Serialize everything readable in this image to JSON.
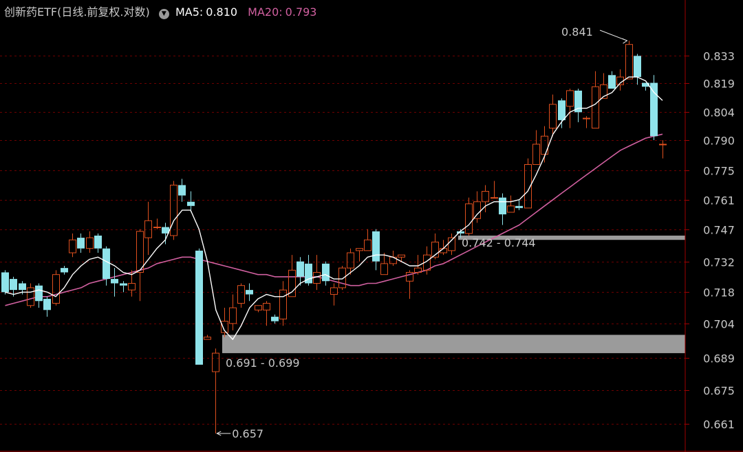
{
  "header": {
    "title": "创新药ETF(日线.前复权.对数)",
    "ma5_label": "MA5:",
    "ma5_value": "0.810",
    "ma20_label": "MA20:",
    "ma20_value": "0.793",
    "toggle_icon": "chevron-down-icon"
  },
  "colors": {
    "background": "#000000",
    "grid": "#6e0000",
    "axis": "#a00000",
    "up": "#e0501e",
    "down": "#8fe3ea",
    "ma5": "#ffffff",
    "ma20": "#d160a0",
    "zone": "#9b9b9b"
  },
  "chart_data": {
    "type": "candlestick",
    "scale": "log",
    "y_ticks": [
      "0.833",
      "0.819",
      "0.804",
      "0.790",
      "0.775",
      "0.761",
      "0.747",
      "0.732",
      "0.718",
      "0.704",
      "0.689",
      "0.675",
      "0.661"
    ],
    "ylim": [
      0.655,
      0.848
    ],
    "grid": true,
    "annotations": [
      {
        "text": "0.841",
        "price": 0.841,
        "type": "high"
      },
      {
        "text": "0.657",
        "price": 0.657,
        "type": "low"
      }
    ],
    "zones": [
      {
        "label": "0.691 - 0.699",
        "low": 0.691,
        "high": 0.699
      },
      {
        "label": "0.742 - 0.744",
        "low": 0.742,
        "high": 0.744
      }
    ],
    "candles": [
      [
        0.727,
        0.718,
        0.728,
        0.717
      ],
      [
        0.724,
        0.719,
        0.725,
        0.716
      ],
      [
        0.722,
        0.719,
        0.723,
        0.717
      ],
      [
        0.712,
        0.72,
        0.722,
        0.711
      ],
      [
        0.721,
        0.714,
        0.722,
        0.711
      ],
      [
        0.715,
        0.71,
        0.716,
        0.707
      ],
      [
        0.713,
        0.726,
        0.728,
        0.712
      ],
      [
        0.729,
        0.727,
        0.73,
        0.726
      ],
      [
        0.736,
        0.742,
        0.745,
        0.734
      ],
      [
        0.743,
        0.738,
        0.745,
        0.736
      ],
      [
        0.738,
        0.743,
        0.746,
        0.736
      ],
      [
        0.744,
        0.738,
        0.745,
        0.736
      ],
      [
        0.738,
        0.724,
        0.739,
        0.721
      ],
      [
        0.724,
        0.722,
        0.729,
        0.716
      ],
      [
        0.722,
        0.721,
        0.723,
        0.718
      ],
      [
        0.719,
        0.722,
        0.728,
        0.716
      ],
      [
        0.727,
        0.746,
        0.747,
        0.714
      ],
      [
        0.743,
        0.751,
        0.76,
        0.735
      ],
      [
        0.748,
        0.748,
        0.752,
        0.747
      ],
      [
        0.748,
        0.745,
        0.75,
        0.74
      ],
      [
        0.744,
        0.768,
        0.77,
        0.742
      ],
      [
        0.768,
        0.763,
        0.771,
        0.76
      ],
      [
        0.76,
        0.758,
        0.765,
        0.755
      ],
      [
        0.737,
        0.686,
        0.738,
        0.686
      ],
      [
        0.697,
        0.698,
        0.699,
        0.697
      ],
      [
        0.683,
        0.691,
        0.693,
        0.657
      ],
      [
        0.7,
        0.705,
        0.711,
        0.698
      ],
      [
        0.704,
        0.711,
        0.717,
        0.701
      ],
      [
        0.713,
        0.721,
        0.722,
        0.711
      ],
      [
        0.719,
        0.717,
        0.722,
        0.714
      ],
      [
        0.71,
        0.712,
        0.712,
        0.709
      ],
      [
        0.71,
        0.713,
        0.714,
        0.703
      ],
      [
        0.707,
        0.705,
        0.708,
        0.704
      ],
      [
        0.706,
        0.719,
        0.723,
        0.703
      ],
      [
        0.716,
        0.728,
        0.735,
        0.716
      ],
      [
        0.732,
        0.725,
        0.734,
        0.721
      ],
      [
        0.731,
        0.722,
        0.735,
        0.721
      ],
      [
        0.722,
        0.727,
        0.735,
        0.719
      ],
      [
        0.731,
        0.723,
        0.732,
        0.721
      ],
      [
        0.717,
        0.72,
        0.722,
        0.712
      ],
      [
        0.72,
        0.729,
        0.73,
        0.719
      ],
      [
        0.729,
        0.736,
        0.738,
        0.726
      ],
      [
        0.737,
        0.738,
        0.738,
        0.732
      ],
      [
        0.737,
        0.742,
        0.747,
        0.737
      ],
      [
        0.746,
        0.732,
        0.747,
        0.728
      ],
      [
        0.726,
        0.731,
        0.736,
        0.726
      ],
      [
        0.731,
        0.734,
        0.737,
        0.73
      ],
      [
        0.734,
        0.735,
        0.735,
        0.732
      ],
      [
        0.723,
        0.727,
        0.728,
        0.715
      ],
      [
        0.727,
        0.729,
        0.735,
        0.726
      ],
      [
        0.728,
        0.735,
        0.739,
        0.726
      ],
      [
        0.734,
        0.741,
        0.745,
        0.733
      ],
      [
        0.736,
        0.738,
        0.742,
        0.735
      ],
      [
        0.737,
        0.743,
        0.745,
        0.735
      ],
      [
        0.746,
        0.745,
        0.747,
        0.743
      ],
      [
        0.745,
        0.759,
        0.762,
        0.744
      ],
      [
        0.752,
        0.76,
        0.765,
        0.75
      ],
      [
        0.76,
        0.765,
        0.768,
        0.755
      ],
      [
        0.762,
        0.762,
        0.77,
        0.762
      ],
      [
        0.762,
        0.754,
        0.764,
        0.749
      ],
      [
        0.755,
        0.758,
        0.763,
        0.755
      ],
      [
        0.758,
        0.757,
        0.761,
        0.756
      ],
      [
        0.757,
        0.778,
        0.781,
        0.757
      ],
      [
        0.778,
        0.788,
        0.795,
        0.778
      ],
      [
        0.783,
        0.792,
        0.797,
        0.779
      ],
      [
        0.796,
        0.808,
        0.813,
        0.792
      ],
      [
        0.81,
        0.8,
        0.811,
        0.796
      ],
      [
        0.807,
        0.815,
        0.816,
        0.796
      ],
      [
        0.815,
        0.804,
        0.816,
        0.799
      ],
      [
        0.801,
        0.801,
        0.802,
        0.796
      ],
      [
        0.796,
        0.817,
        0.825,
        0.796
      ],
      [
        0.811,
        0.818,
        0.824,
        0.811
      ],
      [
        0.823,
        0.816,
        0.825,
        0.816
      ],
      [
        0.818,
        0.822,
        0.826,
        0.815
      ],
      [
        0.821,
        0.839,
        0.841,
        0.821
      ],
      [
        0.833,
        0.822,
        0.834,
        0.818
      ],
      [
        0.819,
        0.817,
        0.819,
        0.815
      ],
      [
        0.819,
        0.792,
        0.823,
        0.79
      ],
      [
        0.788,
        0.788,
        0.79,
        0.781
      ]
    ],
    "ma5": [
      0.718,
      0.717,
      0.718,
      0.718,
      0.719,
      0.718,
      0.716,
      0.72,
      0.726,
      0.73,
      0.733,
      0.734,
      0.732,
      0.73,
      0.727,
      0.726,
      0.728,
      0.733,
      0.738,
      0.742,
      0.751,
      0.756,
      0.756,
      0.747,
      0.732,
      0.71,
      0.701,
      0.697,
      0.703,
      0.711,
      0.715,
      0.717,
      0.716,
      0.716,
      0.718,
      0.722,
      0.724,
      0.725,
      0.726,
      0.724,
      0.724,
      0.727,
      0.73,
      0.734,
      0.735,
      0.735,
      0.734,
      0.732,
      0.73,
      0.73,
      0.732,
      0.735,
      0.738,
      0.742,
      0.746,
      0.749,
      0.754,
      0.758,
      0.76,
      0.76,
      0.76,
      0.761,
      0.765,
      0.773,
      0.782,
      0.793,
      0.799,
      0.804,
      0.806,
      0.806,
      0.808,
      0.812,
      0.814,
      0.819,
      0.822,
      0.822,
      0.82,
      0.814,
      0.81
    ],
    "ma20": [
      0.712,
      0.713,
      0.714,
      0.715,
      0.716,
      0.716,
      0.717,
      0.718,
      0.719,
      0.72,
      0.722,
      0.723,
      0.724,
      0.725,
      0.726,
      0.727,
      0.728,
      0.729,
      0.731,
      0.732,
      0.733,
      0.734,
      0.734,
      0.733,
      0.732,
      0.731,
      0.73,
      0.729,
      0.728,
      0.727,
      0.726,
      0.726,
      0.725,
      0.725,
      0.725,
      0.725,
      0.725,
      0.725,
      0.724,
      0.723,
      0.722,
      0.721,
      0.721,
      0.722,
      0.722,
      0.723,
      0.724,
      0.725,
      0.726,
      0.727,
      0.728,
      0.73,
      0.731,
      0.733,
      0.735,
      0.737,
      0.739,
      0.741,
      0.743,
      0.745,
      0.747,
      0.749,
      0.752,
      0.755,
      0.758,
      0.761,
      0.764,
      0.767,
      0.77,
      0.773,
      0.776,
      0.779,
      0.782,
      0.785,
      0.787,
      0.789,
      0.791,
      0.792,
      0.793
    ]
  }
}
